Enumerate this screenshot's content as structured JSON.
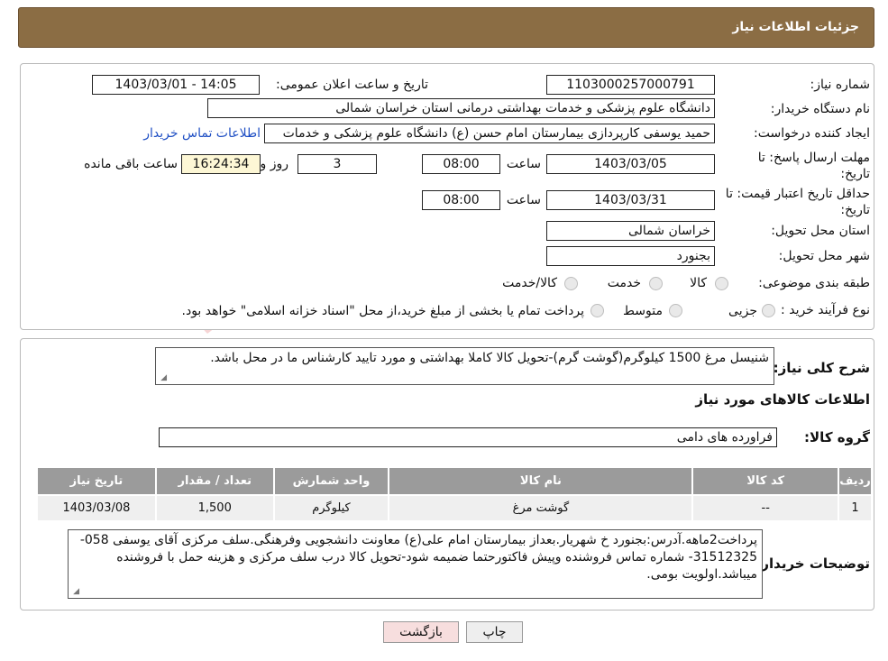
{
  "header": {
    "title": "جزئیات اطلاعات نیاز"
  },
  "form": {
    "need_number_label": "شماره نیاز:",
    "need_number": "1103000257000791",
    "announce_label": "تاریخ و ساعت اعلان عمومی:",
    "announce_value": "1403/03/01 - 14:05",
    "buyer_org_label": "نام دستگاه خریدار:",
    "buyer_org": "دانشگاه علوم پزشکی و خدمات بهداشتی درمانی استان خراسان شمالی",
    "creator_label": "ایجاد کننده درخواست:",
    "creator": "حمید یوسفی کارپردازی بیمارستان امام حسن (ع) دانشگاه علوم پزشکی و خدمات",
    "contact_link": "اطلاعات تماس خریدار",
    "reply_deadline_label": "مهلت ارسال پاسخ: تا تاریخ:",
    "reply_date": "1403/03/05",
    "time_label": "ساعت",
    "reply_time": "08:00",
    "days": "3",
    "days_label": "روز و",
    "remaining_time": "16:24:34",
    "remaining_label": "ساعت باقی مانده",
    "validity_label": "حداقل تاریخ اعتبار قیمت: تا تاریخ:",
    "validity_date": "1403/03/31",
    "validity_time": "08:00",
    "province_label": "استان محل تحویل:",
    "province": "خراسان شمالی",
    "city_label": "شهر محل تحویل:",
    "city": "بجنورد",
    "category_label": "طبقه بندی موضوعی:",
    "category_options": [
      "کالا",
      "خدمت",
      "کالا/خدمت"
    ],
    "process_label": "نوع فرآیند خرید :",
    "process_options": [
      "جزیی",
      "متوسط"
    ],
    "process_note": "پرداخت تمام یا بخشی از مبلغ خرید،از محل \"اسناد خزانه اسلامی\" خواهد بود."
  },
  "summary": {
    "label": "شرح کلی نیاز:",
    "text": "شنیسل مرغ 1500 کیلوگرم(گوشت گرم)-تحویل کالا کاملا بهداشتی و مورد تایید کارشناس ما در محل باشد.",
    "items_heading": "اطلاعات کالاهای مورد نیاز",
    "group_label": "گروه کالا:",
    "group_value": "فراورده های دامی"
  },
  "table": {
    "headers": [
      "ردیف",
      "کد کالا",
      "نام کالا",
      "واحد شمارش",
      "تعداد / مقدار",
      "تاریخ نیاز"
    ],
    "rows": [
      [
        "1",
        "--",
        "گوشت مرغ",
        "کیلوگرم",
        "1,500",
        "1403/03/08"
      ]
    ]
  },
  "notes": {
    "label": "توضیحات خریدار:",
    "text": "پرداخت2ماهه.آدرس:بجنورد خ شهریار.بعداز بیمارستان امام علی(ع) معاونت دانشجویی وفرهنگی.سلف مرکزی آقای یوسفی 058-31512325- شماره تماس فروشنده وپیش فاکتورحتما ضمیمه شود-تحویل کالا درب سلف مرکزی و هزینه حمل با فروشنده میباشد.اولویت بومی."
  },
  "buttons": {
    "print": "چاپ",
    "back": "بازگشت"
  },
  "colors": {
    "header_bg": "#8b6d44",
    "table_header_bg": "#9b9b9b",
    "back_button_bg": "#f7dede",
    "link": "#1f4fc4"
  }
}
